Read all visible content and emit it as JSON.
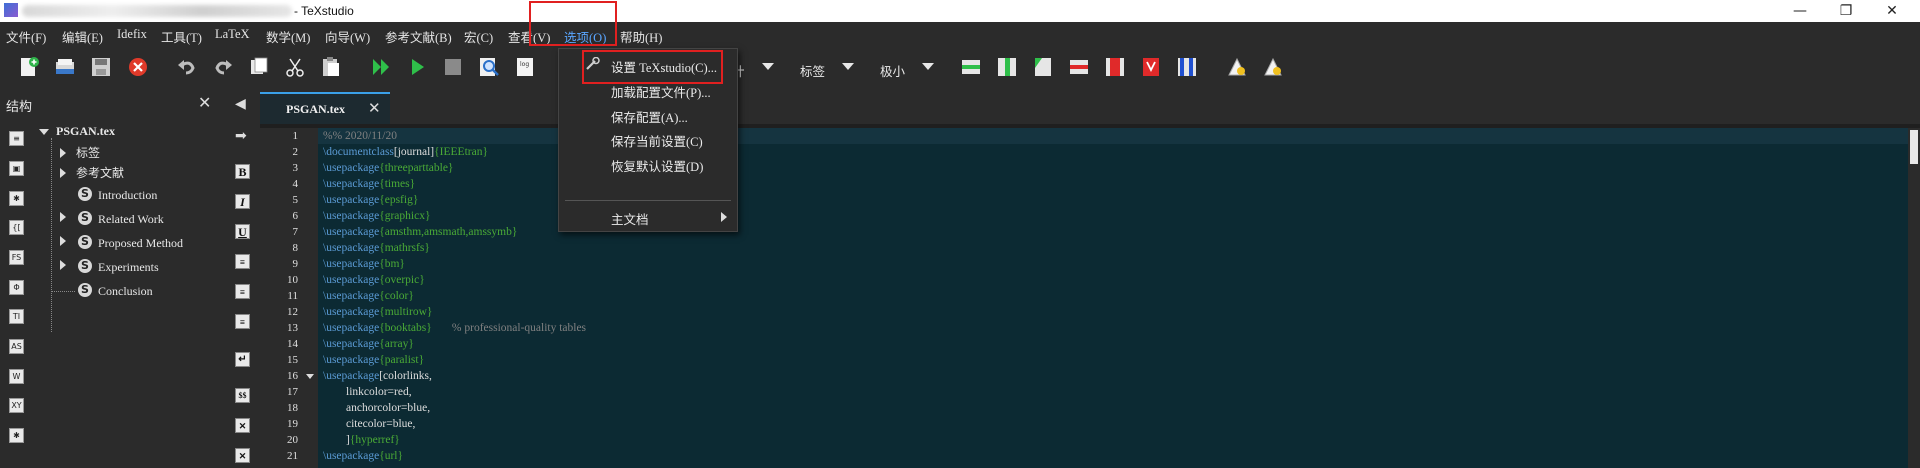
{
  "window": {
    "title": "- TeXstudio",
    "controls": [
      "—",
      "❐",
      "✕"
    ]
  },
  "menubar": {
    "items": [
      {
        "label": "文件(F)"
      },
      {
        "label": "编辑(E)"
      },
      {
        "label": "Idefix"
      },
      {
        "label": "工具(T)"
      },
      {
        "label": "LaTeX"
      },
      {
        "label": "数学(M)"
      },
      {
        "label": "向导(W)"
      },
      {
        "label": "参考文献(B)"
      },
      {
        "label": "宏(C)"
      },
      {
        "label": "查看(V)"
      },
      {
        "label": "选项(O)"
      },
      {
        "label": "帮助(H)"
      }
    ],
    "active": "选项(O)"
  },
  "toolbar": {
    "partial_label": "计",
    "label_dropdown": "标签",
    "size_dropdown": "极小"
  },
  "structure": {
    "title": "结构",
    "close": "✕",
    "root": "PSGAN.tex",
    "items": [
      {
        "label": "标签",
        "expandable": true
      },
      {
        "label": "参考文献",
        "expandable": true
      },
      {
        "label": "Introduction",
        "expandable": false,
        "icon": "S"
      },
      {
        "label": "Related Work",
        "expandable": true,
        "icon": "S"
      },
      {
        "label": "Proposed Method",
        "expandable": true,
        "icon": "S"
      },
      {
        "label": "Experiments",
        "expandable": true,
        "icon": "S"
      },
      {
        "label": "Conclusion",
        "expandable": false,
        "icon": "S"
      }
    ],
    "side_icons": [
      "≡",
      "▣",
      "✱",
      "{[",
      "FS",
      "Φ",
      "TI",
      "AS",
      "W",
      "XY",
      "✱"
    ]
  },
  "sidebar_icons": [
    "◀",
    "➡",
    "B",
    "I",
    "U",
    "≡",
    "≡",
    "≡",
    "↵",
    "$$",
    "✕",
    "✕"
  ],
  "editor": {
    "tab": {
      "name": "PSGAN.tex",
      "close": "✕"
    },
    "lines": [
      {
        "n": "1",
        "parts": [
          {
            "c": "cmt",
            "t": "%% 2020/11/20"
          }
        ]
      },
      {
        "n": "2",
        "parts": [
          {
            "c": "kw",
            "t": "\\documentclass"
          },
          {
            "c": "pl",
            "t": "[journal]"
          },
          {
            "c": "gr",
            "t": "{IEEEtran}"
          }
        ]
      },
      {
        "n": "3",
        "parts": [
          {
            "c": "kw",
            "t": "\\usepackage"
          },
          {
            "c": "gr",
            "t": "{threeparttable}"
          }
        ]
      },
      {
        "n": "4",
        "parts": [
          {
            "c": "kw",
            "t": "\\usepackage"
          },
          {
            "c": "gr",
            "t": "{times}"
          }
        ]
      },
      {
        "n": "5",
        "parts": [
          {
            "c": "kw",
            "t": "\\usepackage"
          },
          {
            "c": "gr",
            "t": "{epsfig}"
          }
        ]
      },
      {
        "n": "6",
        "parts": [
          {
            "c": "kw",
            "t": "\\usepackage"
          },
          {
            "c": "gr",
            "t": "{graphicx}"
          }
        ]
      },
      {
        "n": "7",
        "parts": [
          {
            "c": "kw",
            "t": "\\usepackage"
          },
          {
            "c": "gr",
            "t": "{amsthm,amsmath,amssymb}"
          }
        ]
      },
      {
        "n": "8",
        "parts": [
          {
            "c": "kw",
            "t": "\\usepackage"
          },
          {
            "c": "gr",
            "t": "{mathrsfs}"
          }
        ]
      },
      {
        "n": "9",
        "parts": [
          {
            "c": "kw",
            "t": "\\usepackage"
          },
          {
            "c": "gr",
            "t": "{bm}"
          }
        ]
      },
      {
        "n": "10",
        "parts": [
          {
            "c": "kw",
            "t": "\\usepackage"
          },
          {
            "c": "gr",
            "t": "{overpic}"
          }
        ]
      },
      {
        "n": "11",
        "parts": [
          {
            "c": "kw",
            "t": "\\usepackage"
          },
          {
            "c": "gr",
            "t": "{color}"
          }
        ]
      },
      {
        "n": "12",
        "parts": [
          {
            "c": "kw",
            "t": "\\usepackage"
          },
          {
            "c": "gr",
            "t": "{multirow}"
          }
        ]
      },
      {
        "n": "13",
        "parts": [
          {
            "c": "kw",
            "t": "\\usepackage"
          },
          {
            "c": "gr",
            "t": "{booktabs}"
          },
          {
            "c": "cmt",
            "t": "       % professional-quality tables"
          }
        ]
      },
      {
        "n": "14",
        "parts": [
          {
            "c": "kw",
            "t": "\\usepackage"
          },
          {
            "c": "gr",
            "t": "{array}"
          }
        ]
      },
      {
        "n": "15",
        "parts": [
          {
            "c": "kw",
            "t": "\\usepackage"
          },
          {
            "c": "gr",
            "t": "{paralist}"
          }
        ]
      },
      {
        "n": "16",
        "parts": [
          {
            "c": "kw",
            "t": "\\usepackage"
          },
          {
            "c": "pl",
            "t": "[colorlinks,"
          }
        ]
      },
      {
        "n": "17",
        "parts": [
          {
            "c": "pl",
            "t": "        linkcolor=red,"
          }
        ]
      },
      {
        "n": "18",
        "parts": [
          {
            "c": "pl",
            "t": "        anchorcolor=blue,"
          }
        ]
      },
      {
        "n": "19",
        "parts": [
          {
            "c": "pl",
            "t": "        citecolor=blue,"
          }
        ]
      },
      {
        "n": "20",
        "parts": [
          {
            "c": "pl",
            "t": "        ]"
          },
          {
            "c": "gr",
            "t": "{hyperref}"
          }
        ]
      },
      {
        "n": "21",
        "parts": [
          {
            "c": "kw",
            "t": "\\usepackage"
          },
          {
            "c": "gr",
            "t": "{url}"
          }
        ]
      }
    ]
  },
  "options_menu": {
    "items": [
      {
        "label": "设置 TeXstudio(C)...",
        "highlighted": true
      },
      {
        "label": "加载配置文件(P)..."
      },
      {
        "label": "保存配置(A)..."
      },
      {
        "label": "保存当前设置(C)"
      },
      {
        "label": "恢复默认设置(D)"
      },
      {
        "label": "主文档",
        "submenu": true
      }
    ]
  },
  "colors": {
    "highlight_box": "#e02020",
    "accent": "#3aa0e8",
    "active_menu": "#5aa6ff"
  }
}
